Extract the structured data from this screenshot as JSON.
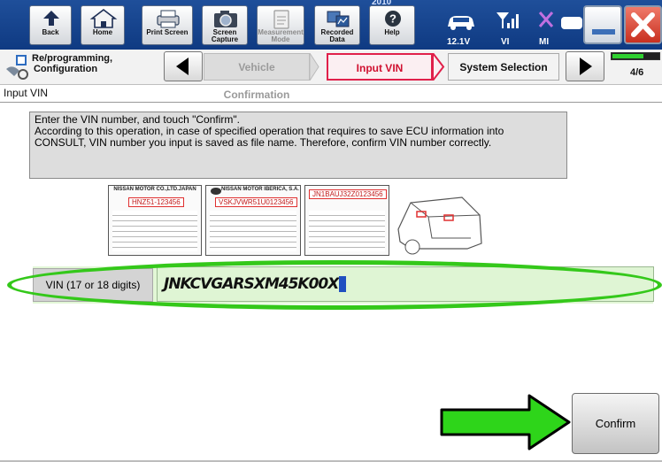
{
  "toolbar": {
    "title_fragment": "2010",
    "back_label": "Back",
    "home_label": "Home",
    "print_screen_label": "Print Screen",
    "screen_capture_label": "Screen Capture",
    "measurement_mode_label": "Measurement Mode",
    "recorded_data_label": "Recorded Data",
    "help_label": "Help",
    "vehicle_indicators": [
      {
        "label": "12.1V",
        "icon": "car-battery-icon"
      },
      {
        "label": "VI",
        "icon": "signal-bars-icon"
      },
      {
        "label": "MI",
        "icon": "mi-cross-icon"
      }
    ]
  },
  "stepbar": {
    "section_label": "Re/programming, Configuration",
    "steps": [
      {
        "label": "Vehicle Confirmation",
        "state": "done"
      },
      {
        "label": "Input VIN",
        "state": "current"
      },
      {
        "label": "System Selection",
        "state": "next"
      }
    ],
    "progress": {
      "text": "4/6",
      "current": 4,
      "total": 6
    }
  },
  "page": {
    "title": "Input VIN",
    "instructions": [
      "Enter the VIN number, and touch \"Confirm\".",
      "According to this operation, in case of specified operation that requires to save ECU information into",
      "CONSULT, VIN number you input is saved as file name. Therefore, confirm VIN number correctly."
    ]
  },
  "illustration": {
    "plate1_header": "NISSAN MOTOR CO.,LTD.JAPAN",
    "plate1_vin": "HNZ51-123456",
    "plate2_header": "NISSAN MOTOR IBERICA, S.A.",
    "plate2_vin": "VSKJVWR51U0123456",
    "plate3_vin": "JN1BAUJ32Z0123456"
  },
  "vin": {
    "label": "VIN (17 or 18 digits)",
    "value": "JNKCVGARSXM45K00X"
  },
  "confirm_label": "Confirm",
  "colors": {
    "toolbar_blue": "#1f4f9a",
    "current_step_red": "#e0204a",
    "highlight_green": "#34c81a",
    "vin_field_bg": "#dff5d4"
  }
}
